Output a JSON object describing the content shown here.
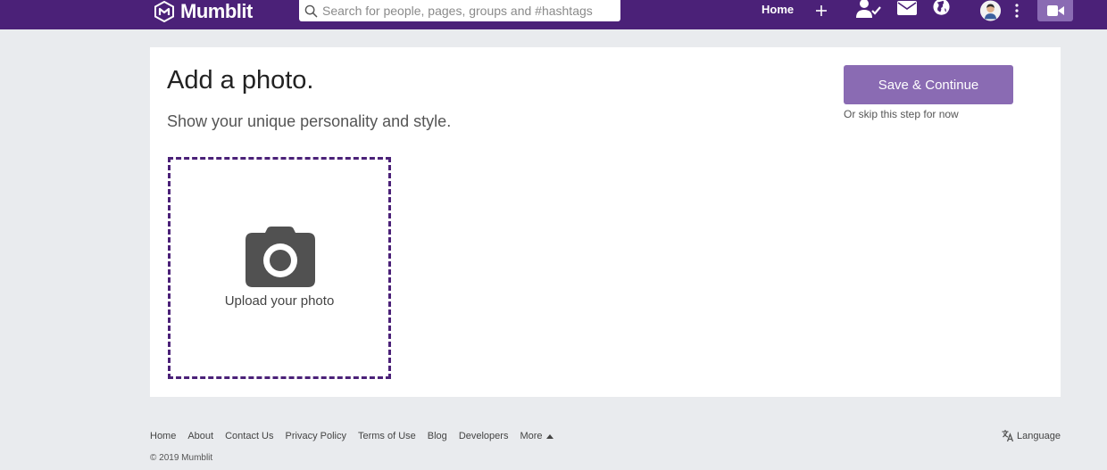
{
  "colors": {
    "brand": "#4b2178",
    "accent": "#8a6bb3",
    "background": "#e9ebee",
    "card": "#ffffff"
  },
  "header": {
    "brand_name": "Mumblit",
    "search_placeholder": "Search for people, pages, groups and #hashtags",
    "search_value": "",
    "nav": {
      "home_label": "Home",
      "icons": [
        "plus-icon",
        "friend-requests-icon",
        "messages-icon",
        "globe-icon",
        "avatar",
        "more-vertical-icon",
        "video-icon"
      ]
    }
  },
  "main": {
    "title": "Add a photo.",
    "subtitle": "Show your unique personality and style.",
    "save_label": "Save & Continue",
    "skip_label": "Or skip this step for now",
    "upload_label": "Upload your photo"
  },
  "footer": {
    "links": [
      "Home",
      "About",
      "Contact Us",
      "Privacy Policy",
      "Terms of Use",
      "Blog",
      "Developers",
      "More"
    ],
    "language_label": "Language",
    "copyright": "© 2019 Mumblit"
  }
}
